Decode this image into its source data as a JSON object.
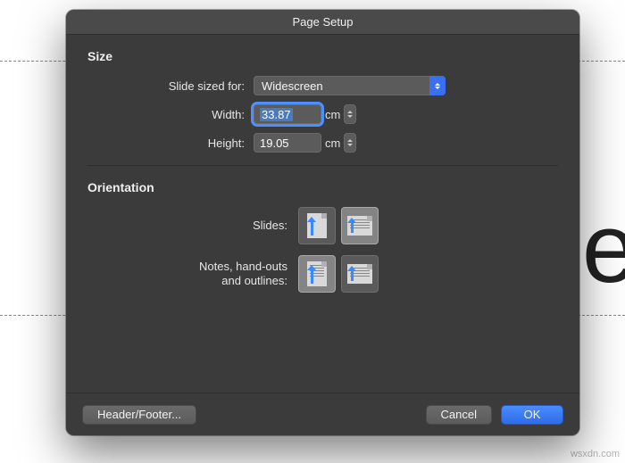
{
  "background": {
    "partial_text": "tle"
  },
  "watermark": "wsxdn.com",
  "dialog": {
    "title": "Page Setup",
    "size": {
      "heading": "Size",
      "slide_sized_for_label": "Slide sized for:",
      "slide_sized_for_value": "Widescreen",
      "width_label": "Width:",
      "width_value": "33.87",
      "width_unit": "cm",
      "height_label": "Height:",
      "height_value": "19.05",
      "height_unit": "cm"
    },
    "orientation": {
      "heading": "Orientation",
      "slides_label": "Slides:",
      "slides_selected": "landscape",
      "notes_label": "Notes, hand-outs\nand outlines:",
      "notes_selected": "portrait"
    },
    "buttons": {
      "header_footer": "Header/Footer...",
      "cancel": "Cancel",
      "ok": "OK"
    }
  }
}
